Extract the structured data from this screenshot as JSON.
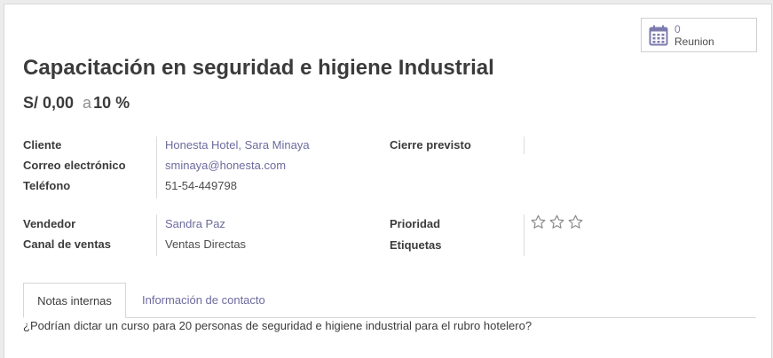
{
  "smart_button": {
    "count": "0",
    "label": "Reunion",
    "icon": "calendar-icon"
  },
  "title": "Capacitación en seguridad e higiene Industrial",
  "revenue": {
    "amount": "S/ 0,00",
    "separator": "a",
    "probability": "10 %"
  },
  "left_fields": [
    {
      "label": "Cliente",
      "value": "Honesta Hotel, Sara Minaya"
    },
    {
      "label": "Correo electrónico",
      "value": "sminaya@honesta.com"
    },
    {
      "label": "Teléfono",
      "value": "51-54-449798"
    },
    {
      "label": "Vendedor",
      "value": "Sandra Paz"
    },
    {
      "label": "Canal de ventas",
      "value": "Ventas Directas"
    }
  ],
  "right_fields": [
    {
      "label": "Cierre previsto",
      "value": ""
    },
    {
      "label": "Prioridad",
      "stars_filled": 0,
      "stars_total": 3
    },
    {
      "label": "Etiquetas",
      "value": ""
    }
  ],
  "tabs": [
    {
      "label": "Notas internas",
      "active": true
    },
    {
      "label": "Información de contacto",
      "active": false
    }
  ],
  "notes": "¿Podrían dictar un curso para 20 personas de seguridad e higiene industrial para el rubro hotelero?",
  "colors": {
    "link": "#6d6b9e",
    "accent": "#7c7bad"
  }
}
